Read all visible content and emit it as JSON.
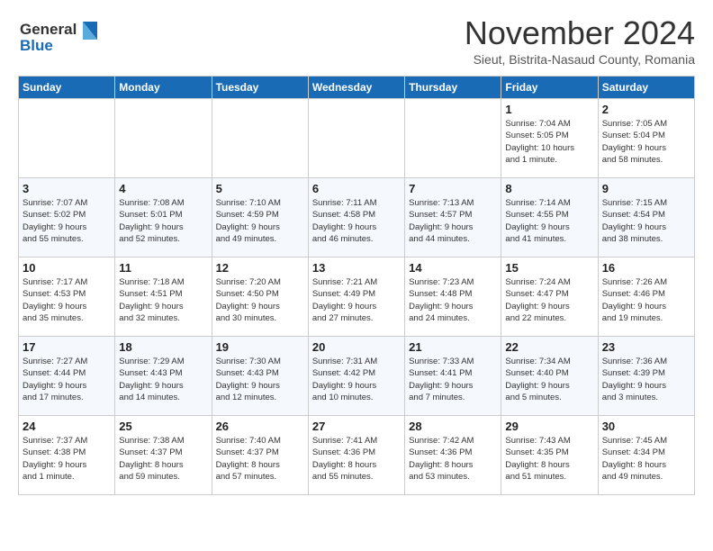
{
  "logo": {
    "line1": "General",
    "line2": "Blue"
  },
  "title": "November 2024",
  "subtitle": "Sieut, Bistrita-Nasaud County, Romania",
  "header_days": [
    "Sunday",
    "Monday",
    "Tuesday",
    "Wednesday",
    "Thursday",
    "Friday",
    "Saturday"
  ],
  "weeks": [
    [
      {
        "day": "",
        "info": ""
      },
      {
        "day": "",
        "info": ""
      },
      {
        "day": "",
        "info": ""
      },
      {
        "day": "",
        "info": ""
      },
      {
        "day": "",
        "info": ""
      },
      {
        "day": "1",
        "info": "Sunrise: 7:04 AM\nSunset: 5:05 PM\nDaylight: 10 hours\nand 1 minute."
      },
      {
        "day": "2",
        "info": "Sunrise: 7:05 AM\nSunset: 5:04 PM\nDaylight: 9 hours\nand 58 minutes."
      }
    ],
    [
      {
        "day": "3",
        "info": "Sunrise: 7:07 AM\nSunset: 5:02 PM\nDaylight: 9 hours\nand 55 minutes."
      },
      {
        "day": "4",
        "info": "Sunrise: 7:08 AM\nSunset: 5:01 PM\nDaylight: 9 hours\nand 52 minutes."
      },
      {
        "day": "5",
        "info": "Sunrise: 7:10 AM\nSunset: 4:59 PM\nDaylight: 9 hours\nand 49 minutes."
      },
      {
        "day": "6",
        "info": "Sunrise: 7:11 AM\nSunset: 4:58 PM\nDaylight: 9 hours\nand 46 minutes."
      },
      {
        "day": "7",
        "info": "Sunrise: 7:13 AM\nSunset: 4:57 PM\nDaylight: 9 hours\nand 44 minutes."
      },
      {
        "day": "8",
        "info": "Sunrise: 7:14 AM\nSunset: 4:55 PM\nDaylight: 9 hours\nand 41 minutes."
      },
      {
        "day": "9",
        "info": "Sunrise: 7:15 AM\nSunset: 4:54 PM\nDaylight: 9 hours\nand 38 minutes."
      }
    ],
    [
      {
        "day": "10",
        "info": "Sunrise: 7:17 AM\nSunset: 4:53 PM\nDaylight: 9 hours\nand 35 minutes."
      },
      {
        "day": "11",
        "info": "Sunrise: 7:18 AM\nSunset: 4:51 PM\nDaylight: 9 hours\nand 32 minutes."
      },
      {
        "day": "12",
        "info": "Sunrise: 7:20 AM\nSunset: 4:50 PM\nDaylight: 9 hours\nand 30 minutes."
      },
      {
        "day": "13",
        "info": "Sunrise: 7:21 AM\nSunset: 4:49 PM\nDaylight: 9 hours\nand 27 minutes."
      },
      {
        "day": "14",
        "info": "Sunrise: 7:23 AM\nSunset: 4:48 PM\nDaylight: 9 hours\nand 24 minutes."
      },
      {
        "day": "15",
        "info": "Sunrise: 7:24 AM\nSunset: 4:47 PM\nDaylight: 9 hours\nand 22 minutes."
      },
      {
        "day": "16",
        "info": "Sunrise: 7:26 AM\nSunset: 4:46 PM\nDaylight: 9 hours\nand 19 minutes."
      }
    ],
    [
      {
        "day": "17",
        "info": "Sunrise: 7:27 AM\nSunset: 4:44 PM\nDaylight: 9 hours\nand 17 minutes."
      },
      {
        "day": "18",
        "info": "Sunrise: 7:29 AM\nSunset: 4:43 PM\nDaylight: 9 hours\nand 14 minutes."
      },
      {
        "day": "19",
        "info": "Sunrise: 7:30 AM\nSunset: 4:43 PM\nDaylight: 9 hours\nand 12 minutes."
      },
      {
        "day": "20",
        "info": "Sunrise: 7:31 AM\nSunset: 4:42 PM\nDaylight: 9 hours\nand 10 minutes."
      },
      {
        "day": "21",
        "info": "Sunrise: 7:33 AM\nSunset: 4:41 PM\nDaylight: 9 hours\nand 7 minutes."
      },
      {
        "day": "22",
        "info": "Sunrise: 7:34 AM\nSunset: 4:40 PM\nDaylight: 9 hours\nand 5 minutes."
      },
      {
        "day": "23",
        "info": "Sunrise: 7:36 AM\nSunset: 4:39 PM\nDaylight: 9 hours\nand 3 minutes."
      }
    ],
    [
      {
        "day": "24",
        "info": "Sunrise: 7:37 AM\nSunset: 4:38 PM\nDaylight: 9 hours\nand 1 minute."
      },
      {
        "day": "25",
        "info": "Sunrise: 7:38 AM\nSunset: 4:37 PM\nDaylight: 8 hours\nand 59 minutes."
      },
      {
        "day": "26",
        "info": "Sunrise: 7:40 AM\nSunset: 4:37 PM\nDaylight: 8 hours\nand 57 minutes."
      },
      {
        "day": "27",
        "info": "Sunrise: 7:41 AM\nSunset: 4:36 PM\nDaylight: 8 hours\nand 55 minutes."
      },
      {
        "day": "28",
        "info": "Sunrise: 7:42 AM\nSunset: 4:36 PM\nDaylight: 8 hours\nand 53 minutes."
      },
      {
        "day": "29",
        "info": "Sunrise: 7:43 AM\nSunset: 4:35 PM\nDaylight: 8 hours\nand 51 minutes."
      },
      {
        "day": "30",
        "info": "Sunrise: 7:45 AM\nSunset: 4:34 PM\nDaylight: 8 hours\nand 49 minutes."
      }
    ]
  ]
}
